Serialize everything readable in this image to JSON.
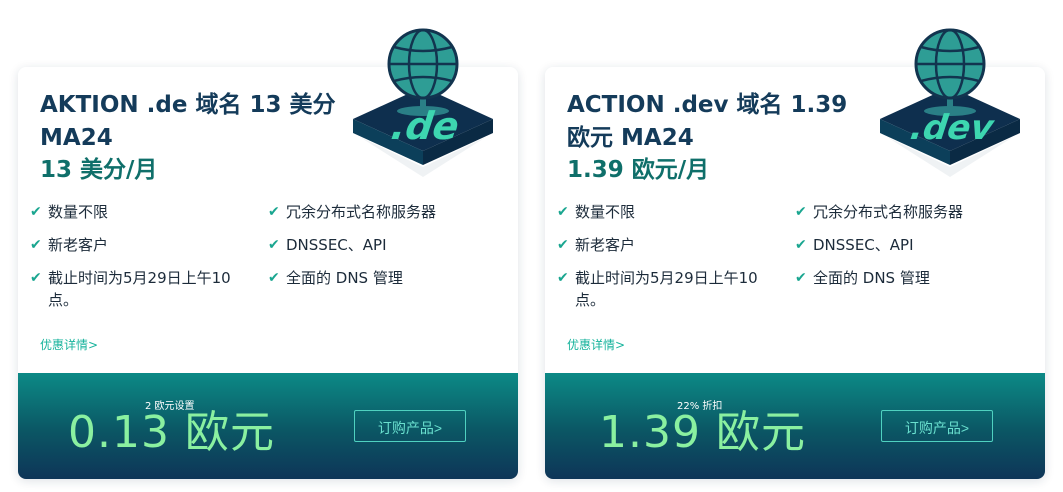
{
  "cards": [
    {
      "title": "AKTION .de 域名 13 美分 MA24",
      "subtitle": "13 美分/月",
      "tld_label": ".de",
      "features": [
        "数量不限",
        "新老客户",
        "截止时间为5月29日上午10点。",
        "冗余分布式名称服务器",
        "DNSSEC、API",
        "全面的 DNS 管理"
      ],
      "details_link": "优惠详情>",
      "price_note": "2 欧元设置",
      "price": "0.13 欧元",
      "order_button": "订购产品>"
    },
    {
      "title": "ACTION .dev 域名 1.39 欧元 MA24",
      "subtitle": "1.39 欧元/月",
      "tld_label": ".dev",
      "features": [
        "数量不限",
        "新老客户",
        "截止时间为5月29日上午10点。",
        "冗余分布式名称服务器",
        "DNSSEC、API",
        "全面的 DNS 管理"
      ],
      "details_link": "优惠详情>",
      "price_note": "22% 折扣",
      "price": "1.39 欧元",
      "order_button": "订购产品>"
    }
  ],
  "colors": {
    "title": "#143b5a",
    "subtitle": "#0f6f6a",
    "check": "#1aa690",
    "price": "#8af0a0",
    "bar_top": "#0c8a86",
    "bar_bottom": "#0e3558"
  },
  "icons": {
    "check": "check-icon",
    "globe": "globe-icon"
  }
}
